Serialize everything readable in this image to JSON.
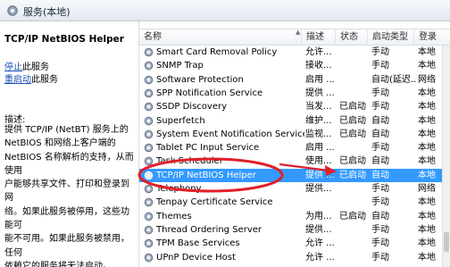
{
  "window": {
    "title": "服务(本地)"
  },
  "left_pane": {
    "service_title": "TCP/IP NetBIOS Helper",
    "actions": [
      {
        "link": "停止",
        "suffix": "此服务"
      },
      {
        "link": "重启动",
        "suffix": "此服务"
      }
    ],
    "description_label": "描述:",
    "description_lines": [
      "提供 TCP/IP (NetBT) 服务上的",
      "NetBIOS 和网络上客户端的",
      "NetBIOS 名称解析的支持，从而使用",
      "户能够共享文件、打印和登录到网",
      "络。如果此服务被停用，这些功能可",
      "能不可用。如果此服务被禁用，任何",
      "依赖它的服务将无法启动。"
    ]
  },
  "table": {
    "columns": [
      "名称",
      "描述",
      "状态",
      "启动类型",
      "登录"
    ],
    "rows": [
      {
        "name": "Smart Card Removal Policy",
        "desc": "允许...",
        "status": "",
        "startup": "手动",
        "logon": "本地"
      },
      {
        "name": "SNMP Trap",
        "desc": "接收...",
        "status": "",
        "startup": "手动",
        "logon": "本地"
      },
      {
        "name": "Software Protection",
        "desc": "启用 ...",
        "status": "",
        "startup": "自动(延迟...",
        "logon": "网络"
      },
      {
        "name": "SPP Notification Service",
        "desc": "提供 ...",
        "status": "",
        "startup": "手动",
        "logon": "本地"
      },
      {
        "name": "SSDP Discovery",
        "desc": "当发...",
        "status": "已启动",
        "startup": "手动",
        "logon": "本地"
      },
      {
        "name": "Superfetch",
        "desc": "维护...",
        "status": "已启动",
        "startup": "自动",
        "logon": "本地"
      },
      {
        "name": "System Event Notification Service",
        "desc": "监视...",
        "status": "已启动",
        "startup": "自动",
        "logon": "本地"
      },
      {
        "name": "Tablet PC Input Service",
        "desc": "启用 ...",
        "status": "",
        "startup": "手动",
        "logon": "本地"
      },
      {
        "name": "Task Scheduler",
        "desc": "使用...",
        "status": "已启动",
        "startup": "自动",
        "logon": "本地"
      },
      {
        "name": "TCP/IP NetBIOS Helper",
        "desc": "提供 ...",
        "status": "已启动",
        "startup": "自动",
        "logon": "本地",
        "selected": true
      },
      {
        "name": "Telephony",
        "desc": "提供...",
        "status": "",
        "startup": "手动",
        "logon": "网络"
      },
      {
        "name": "Tenpay Certificate Service",
        "desc": "",
        "status": "",
        "startup": "手动",
        "logon": "本地"
      },
      {
        "name": "Themes",
        "desc": "为用...",
        "status": "已启动",
        "startup": "自动",
        "logon": "本地"
      },
      {
        "name": "Thread Ordering Server",
        "desc": "提供...",
        "status": "",
        "startup": "手动",
        "logon": "本地"
      },
      {
        "name": "TPM Base Services",
        "desc": "允许 ...",
        "status": "",
        "startup": "手动",
        "logon": "本地"
      },
      {
        "name": "UPnP Device Host",
        "desc": "允许 ...",
        "status": "",
        "startup": "手动",
        "logon": "本地"
      }
    ]
  },
  "colors": {
    "selection": "#3399ff",
    "link": "#1a4fb5",
    "annotation": "#e0202a"
  },
  "icons": {
    "window": "gear-icon",
    "row": "service-gear-icon"
  }
}
